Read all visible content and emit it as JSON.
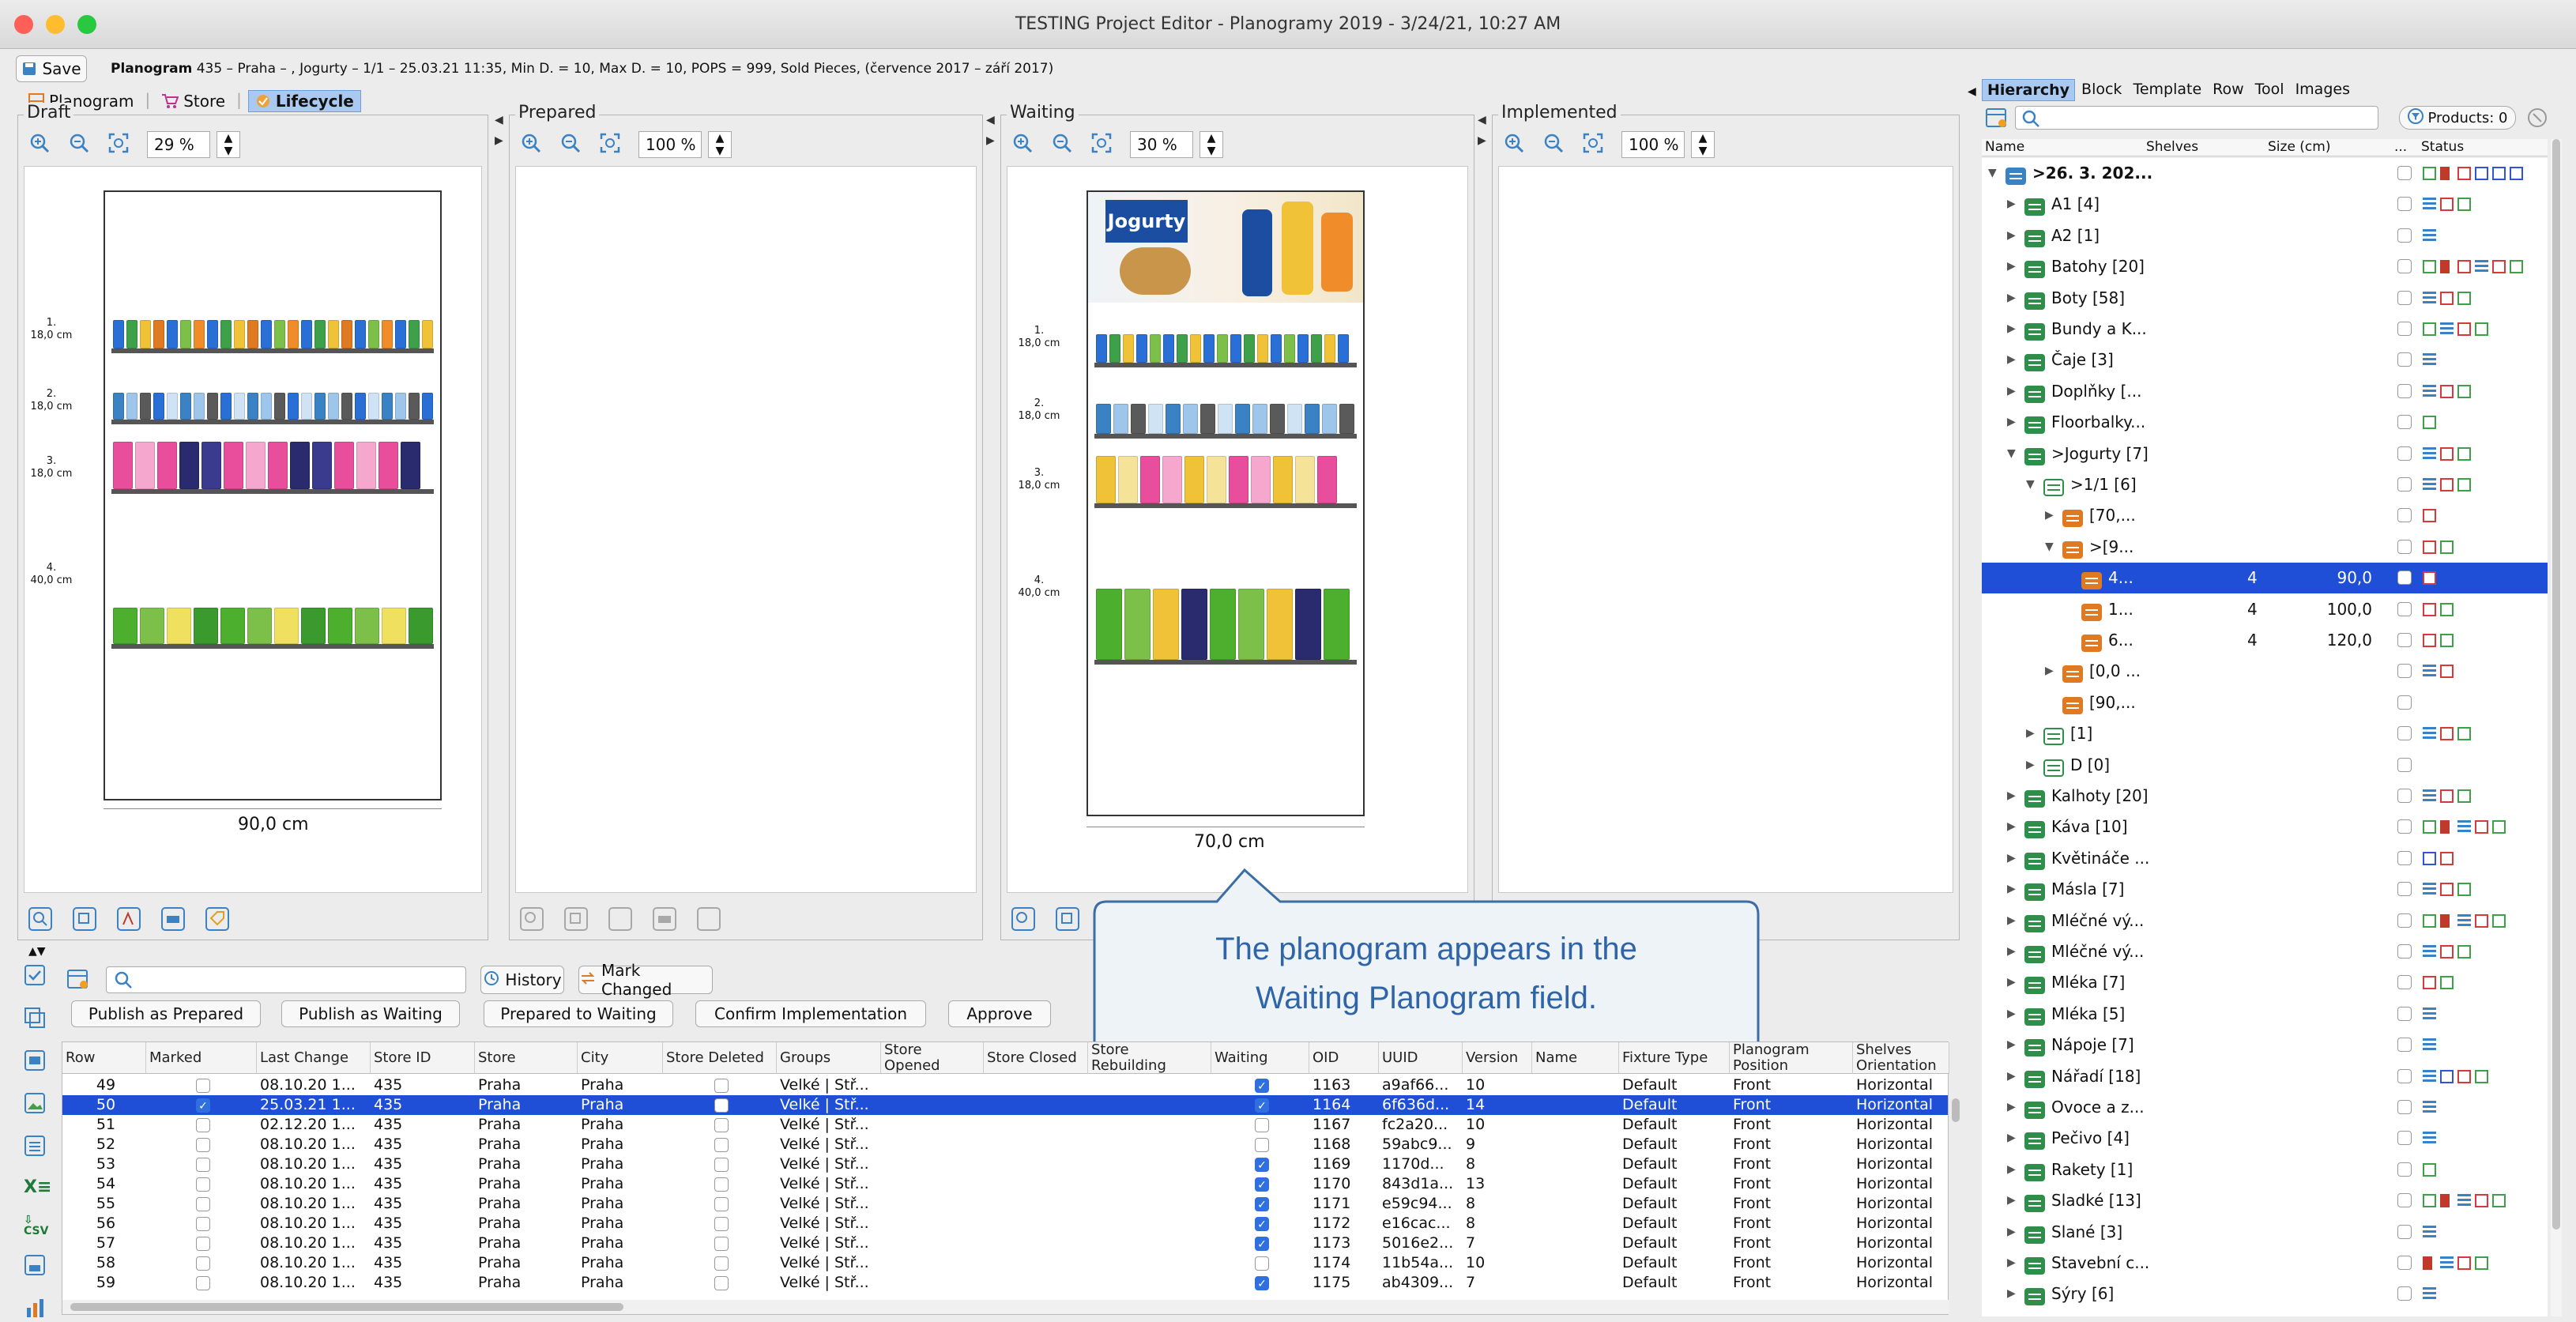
{
  "window": {
    "title": "TESTING Project Editor - Planogramy 2019 - 3/24/21, 10:27 AM"
  },
  "toolbar": {
    "save_label": "Save",
    "info_bold": "Planogram",
    "info_text": "435 – Praha – , Jogurty – 1/1 – 25.03.21 11:35, Min D. = 10, Max D. = 10, POPS = 999, Sold Pieces, (července 2017 – září 2017)"
  },
  "tabs": [
    {
      "label": "Planogram"
    },
    {
      "label": "Store"
    },
    {
      "label": "Lifecycle"
    }
  ],
  "panels": {
    "draft": {
      "label": "Draft",
      "zoom": "29 %",
      "width_label": "90,0 cm",
      "shelves": [
        {
          "n": "1.",
          "h": "18,0 cm"
        },
        {
          "n": "2.",
          "h": "18,0 cm"
        },
        {
          "n": "3.",
          "h": "18,0 cm"
        },
        {
          "n": "4.",
          "h": "40,0 cm"
        }
      ]
    },
    "prepared": {
      "label": "Prepared",
      "zoom": "100 %"
    },
    "waiting": {
      "label": "Waiting",
      "zoom": "30 %",
      "width_label": "70,0 cm",
      "banner": "Jogurty",
      "shelves": [
        {
          "n": "1.",
          "h": "18,0 cm"
        },
        {
          "n": "2.",
          "h": "18,0 cm"
        },
        {
          "n": "3.",
          "h": "18,0 cm"
        },
        {
          "n": "4.",
          "h": "40,0 cm"
        }
      ]
    },
    "implemented": {
      "label": "Implemented",
      "zoom": "100 %"
    }
  },
  "callout": {
    "line1": "The planogram appears in the",
    "line2": "Waiting Planogram field."
  },
  "bottom": {
    "history": "History",
    "mark_changed": "Mark Changed",
    "actions": [
      "Publish as Prepared",
      "Publish as Waiting",
      "Prepared to Waiting",
      "Confirm Implementation",
      "Approve"
    ],
    "columns": [
      "Row",
      "Marked",
      "Last Change",
      "Store ID",
      "Store",
      "City",
      "Store Deleted",
      "Groups",
      "Store Opened",
      "Store Closed",
      "Store Rebuilding",
      "Waiting",
      "OID",
      "UUID",
      "Version",
      "Name",
      "Fixture Type",
      "Planogram Position",
      "Shelves Orientation"
    ],
    "rows": [
      {
        "row": "49",
        "marked": false,
        "last": "08.10.20 1...",
        "sid": "435",
        "store": "Praha",
        "city": "Praha",
        "groups": "Velké | Stř...",
        "waiting": true,
        "oid": "1163",
        "uuid": "a9af66...",
        "ver": "10",
        "ft": "Default",
        "pos": "Front",
        "orient": "Horizontal"
      },
      {
        "row": "50",
        "marked": true,
        "last": "25.03.21 1...",
        "sid": "435",
        "store": "Praha",
        "city": "Praha",
        "groups": "Velké | Stř...",
        "waiting": true,
        "oid": "1164",
        "uuid": "6f636d...",
        "ver": "14",
        "ft": "Default",
        "pos": "Front",
        "orient": "Horizontal"
      },
      {
        "row": "51",
        "marked": false,
        "last": "02.12.20 1...",
        "sid": "435",
        "store": "Praha",
        "city": "Praha",
        "groups": "Velké | Stř...",
        "waiting": false,
        "oid": "1167",
        "uuid": "fc2a20...",
        "ver": "10",
        "ft": "Default",
        "pos": "Front",
        "orient": "Horizontal"
      },
      {
        "row": "52",
        "marked": false,
        "last": "08.10.20 1...",
        "sid": "435",
        "store": "Praha",
        "city": "Praha",
        "groups": "Velké | Stř...",
        "waiting": false,
        "oid": "1168",
        "uuid": "59abc9...",
        "ver": "9",
        "ft": "Default",
        "pos": "Front",
        "orient": "Horizontal"
      },
      {
        "row": "53",
        "marked": false,
        "last": "08.10.20 1...",
        "sid": "435",
        "store": "Praha",
        "city": "Praha",
        "groups": "Velké | Stř...",
        "waiting": true,
        "oid": "1169",
        "uuid": "1170d...",
        "ver": "8",
        "ft": "Default",
        "pos": "Front",
        "orient": "Horizontal"
      },
      {
        "row": "54",
        "marked": false,
        "last": "08.10.20 1...",
        "sid": "435",
        "store": "Praha",
        "city": "Praha",
        "groups": "Velké | Stř...",
        "waiting": true,
        "oid": "1170",
        "uuid": "843d1a...",
        "ver": "13",
        "ft": "Default",
        "pos": "Front",
        "orient": "Horizontal"
      },
      {
        "row": "55",
        "marked": false,
        "last": "08.10.20 1...",
        "sid": "435",
        "store": "Praha",
        "city": "Praha",
        "groups": "Velké | Stř...",
        "waiting": true,
        "oid": "1171",
        "uuid": "e59c94...",
        "ver": "8",
        "ft": "Default",
        "pos": "Front",
        "orient": "Horizontal"
      },
      {
        "row": "56",
        "marked": false,
        "last": "08.10.20 1...",
        "sid": "435",
        "store": "Praha",
        "city": "Praha",
        "groups": "Velké | Stř...",
        "waiting": true,
        "oid": "1172",
        "uuid": "e16cac...",
        "ver": "8",
        "ft": "Default",
        "pos": "Front",
        "orient": "Horizontal"
      },
      {
        "row": "57",
        "marked": false,
        "last": "08.10.20 1...",
        "sid": "435",
        "store": "Praha",
        "city": "Praha",
        "groups": "Velké | Stř...",
        "waiting": true,
        "oid": "1173",
        "uuid": "5016e2...",
        "ver": "7",
        "ft": "Default",
        "pos": "Front",
        "orient": "Horizontal"
      },
      {
        "row": "58",
        "marked": false,
        "last": "08.10.20 1...",
        "sid": "435",
        "store": "Praha",
        "city": "Praha",
        "groups": "Velké | Stř...",
        "waiting": false,
        "oid": "1174",
        "uuid": "11b54a...",
        "ver": "10",
        "ft": "Default",
        "pos": "Front",
        "orient": "Horizontal"
      },
      {
        "row": "59",
        "marked": false,
        "last": "08.10.20 1...",
        "sid": "435",
        "store": "Praha",
        "city": "Praha",
        "groups": "Velké | Stř...",
        "waiting": true,
        "oid": "1175",
        "uuid": "ab4309...",
        "ver": "7",
        "ft": "Default",
        "pos": "Front",
        "orient": "Horizontal"
      }
    ]
  },
  "right": {
    "tabs": [
      "Hierarchy",
      "Block",
      "Template",
      "Row",
      "Tool",
      "Images"
    ],
    "products": "Products: 0",
    "cols": [
      "Name",
      "Shelves",
      "Size (cm)",
      "...",
      "Status"
    ],
    "tree": [
      {
        "name": ">26. 3. 202...",
        "lvl": 0,
        "type": "root",
        "arrow": "▼",
        "bold": true,
        "st": "gqrbbb"
      },
      {
        "name": "A1 [4]",
        "lvl": 1,
        "type": "g",
        "arrow": "▶",
        "st": "lrg"
      },
      {
        "name": "A2 [1]",
        "lvl": 1,
        "type": "g",
        "arrow": "▶",
        "st": "l"
      },
      {
        "name": "Batohy [20]",
        "lvl": 1,
        "type": "g",
        "arrow": "▶",
        "st": "gqrlrg"
      },
      {
        "name": "Boty [58]",
        "lvl": 1,
        "type": "g",
        "arrow": "▶",
        "st": "lrg"
      },
      {
        "name": "Bundy a K...",
        "lvl": 1,
        "type": "g",
        "arrow": "▶",
        "st": "glrg"
      },
      {
        "name": "Čaje [3]",
        "lvl": 1,
        "type": "g",
        "arrow": "▶",
        "st": "l"
      },
      {
        "name": "Doplňky [...",
        "lvl": 1,
        "type": "g",
        "arrow": "▶",
        "st": "lrg"
      },
      {
        "name": "Floorbalky...",
        "lvl": 1,
        "type": "g",
        "arrow": "▶",
        "st": "g"
      },
      {
        "name": ">Jogurty [7]",
        "lvl": 1,
        "type": "g",
        "arrow": "▼",
        "st": "lrg"
      },
      {
        "name": ">1/1 [6]",
        "lvl": 2,
        "type": "gl",
        "arrow": "▼",
        "st": "lrg"
      },
      {
        "name": "[70,...",
        "lvl": 3,
        "type": "o",
        "arrow": "▶",
        "st": "r"
      },
      {
        "name": ">[9...",
        "lvl": 3,
        "type": "o",
        "arrow": "▼",
        "st": "rg"
      },
      {
        "name": "4...",
        "lvl": 4,
        "type": "o",
        "arrow": "",
        "shelves": "4",
        "size": "90,0",
        "st": "r",
        "sel": true
      },
      {
        "name": "1...",
        "lvl": 4,
        "type": "o",
        "arrow": "",
        "shelves": "4",
        "size": "100,0",
        "st": "rg"
      },
      {
        "name": "6...",
        "lvl": 4,
        "type": "o",
        "arrow": "",
        "shelves": "4",
        "size": "120,0",
        "st": "rg"
      },
      {
        "name": "[0,0 ...",
        "lvl": 3,
        "type": "o",
        "arrow": "▶",
        "st": "lr"
      },
      {
        "name": "[90,...",
        "lvl": 3,
        "type": "o",
        "arrow": "",
        "st": ""
      },
      {
        "name": "[1]",
        "lvl": 2,
        "type": "gl",
        "arrow": "▶",
        "st": "lrg"
      },
      {
        "name": "D [0]",
        "lvl": 2,
        "type": "gl",
        "arrow": "▶",
        "st": ""
      },
      {
        "name": "Kalhoty [20]",
        "lvl": 1,
        "type": "g",
        "arrow": "▶",
        "st": "lrg"
      },
      {
        "name": "Káva [10]",
        "lvl": 1,
        "type": "g",
        "arrow": "▶",
        "st": "gqlrg"
      },
      {
        "name": "Květináče ...",
        "lvl": 1,
        "type": "g",
        "arrow": "▶",
        "st": "br"
      },
      {
        "name": "Másla [7]",
        "lvl": 1,
        "type": "g",
        "arrow": "▶",
        "st": "lrg"
      },
      {
        "name": "Mléčné vý...",
        "lvl": 1,
        "type": "g",
        "arrow": "▶",
        "st": "gqlrg"
      },
      {
        "name": "Mléčné vý...",
        "lvl": 1,
        "type": "g",
        "arrow": "▶",
        "st": "lrg"
      },
      {
        "name": "Mléka [7]",
        "lvl": 1,
        "type": "g",
        "arrow": "▶",
        "st": "rg"
      },
      {
        "name": "Mléka [5]",
        "lvl": 1,
        "type": "g",
        "arrow": "▶",
        "st": "l"
      },
      {
        "name": "Nápoje [7]",
        "lvl": 1,
        "type": "g",
        "arrow": "▶",
        "st": "l"
      },
      {
        "name": "Nářadí [18]",
        "lvl": 1,
        "type": "g",
        "arrow": "▶",
        "st": "lbrg"
      },
      {
        "name": "Ovoce a z...",
        "lvl": 1,
        "type": "g",
        "arrow": "▶",
        "st": "l"
      },
      {
        "name": "Pečivo [4]",
        "lvl": 1,
        "type": "g",
        "arrow": "▶",
        "st": "l"
      },
      {
        "name": "Rakety [1]",
        "lvl": 1,
        "type": "g",
        "arrow": "▶",
        "st": "g"
      },
      {
        "name": "Sladké [13]",
        "lvl": 1,
        "type": "g",
        "arrow": "▶",
        "st": "gqlrg"
      },
      {
        "name": "Slané [3]",
        "lvl": 1,
        "type": "g",
        "arrow": "▶",
        "st": "l"
      },
      {
        "name": "Stavební c...",
        "lvl": 1,
        "type": "g",
        "arrow": "▶",
        "st": "qlrg"
      },
      {
        "name": "Sýry [6]",
        "lvl": 1,
        "type": "g",
        "arrow": "▶",
        "st": "l"
      }
    ]
  }
}
